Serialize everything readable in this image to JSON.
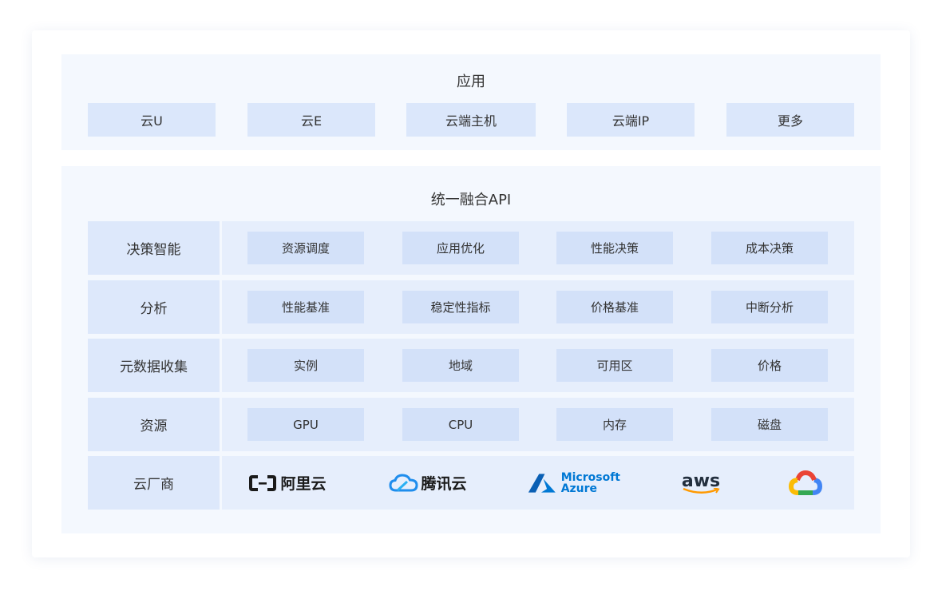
{
  "app_layer": {
    "title": "应用",
    "items": [
      "云U",
      "云E",
      "云端主机",
      "云端IP",
      "更多"
    ]
  },
  "api_layer": {
    "title": "统一融合API",
    "rows": [
      {
        "label": "决策智能",
        "items": [
          "资源调度",
          "应用优化",
          "性能决策",
          "成本决策"
        ]
      },
      {
        "label": "分析",
        "items": [
          "性能基准",
          "稳定性指标",
          "价格基准",
          "中断分析"
        ]
      },
      {
        "label": "元数据收集",
        "items": [
          "实例",
          "地域",
          "可用区",
          "价格"
        ]
      },
      {
        "label": "资源",
        "items": [
          "GPU",
          "CPU",
          "内存",
          "磁盘"
        ]
      }
    ],
    "vendors": {
      "label": "云厂商",
      "aliyun": "阿里云",
      "tencent": "腾讯云",
      "microsoft_line1": "Microsoft",
      "microsoft_line2": "Azure",
      "aws": "aws",
      "google_icon": "google-cloud-icon"
    }
  },
  "colors": {
    "panel_bg": "#f4f8fe",
    "box": "#dbe7fb",
    "cell": "#d3e1f9",
    "azure": "#0078d4",
    "aws_smile": "#ff9900"
  }
}
